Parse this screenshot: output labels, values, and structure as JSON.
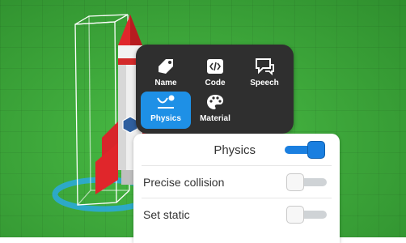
{
  "menu": {
    "items": [
      {
        "label": "Name",
        "icon": "tag-icon"
      },
      {
        "label": "Code",
        "icon": "code-icon"
      },
      {
        "label": "Speech",
        "icon": "speech-bubble-icon"
      },
      {
        "label": "Physics",
        "icon": "physics-icon",
        "active": true
      },
      {
        "label": "Material",
        "icon": "palette-icon"
      }
    ]
  },
  "panel": {
    "title": "Physics",
    "physics_enabled": true,
    "rows": [
      {
        "label": "Precise collision",
        "enabled": false
      },
      {
        "label": "Set static",
        "enabled": false
      }
    ]
  },
  "colors": {
    "ground": "#3ea83b",
    "menu_bg": "#2f2f2f",
    "accent": "#1a7fe0",
    "rocket_red": "#e0262b"
  }
}
